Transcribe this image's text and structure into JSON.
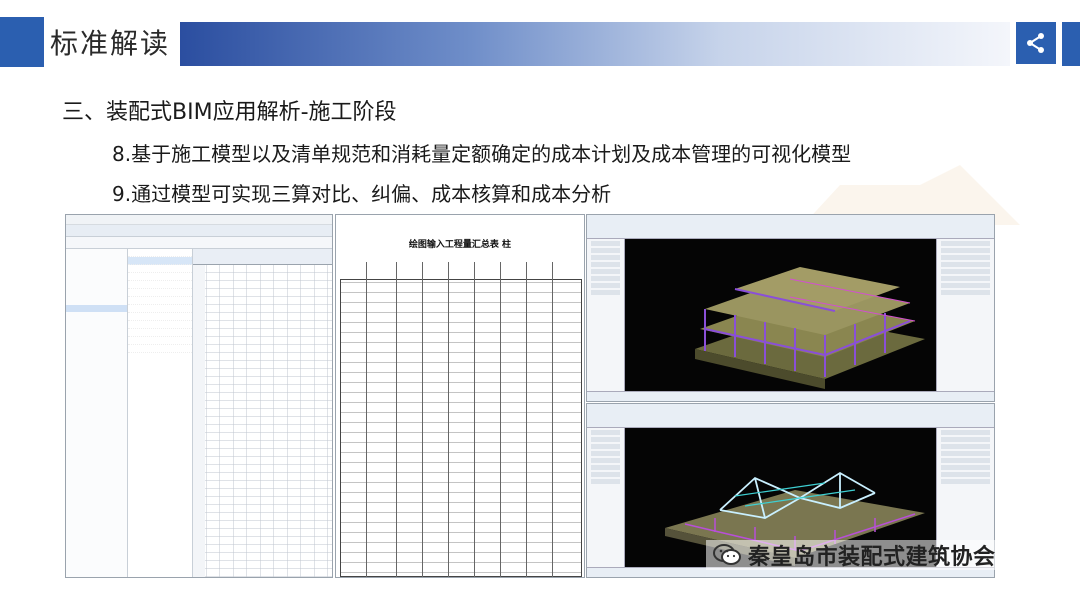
{
  "header": {
    "title": "标准解读",
    "share_icon": "share-icon",
    "accent": "#2b5fb0"
  },
  "content": {
    "heading": "三、装配式BIM应用解析-施工阶段",
    "point8": "8.基于施工模型以及清单规范和消耗量定额确定的成本计划及成本管理的可视化模型",
    "point9": "9.通过模型可实现三算对比、纠偏、成本核算和成本分析"
  },
  "sheet": {
    "title": "绘图输入工程量汇总表  柱"
  },
  "credit": {
    "icon": "wechat-icon",
    "text": "秦皇岛市装配式建筑协会"
  }
}
